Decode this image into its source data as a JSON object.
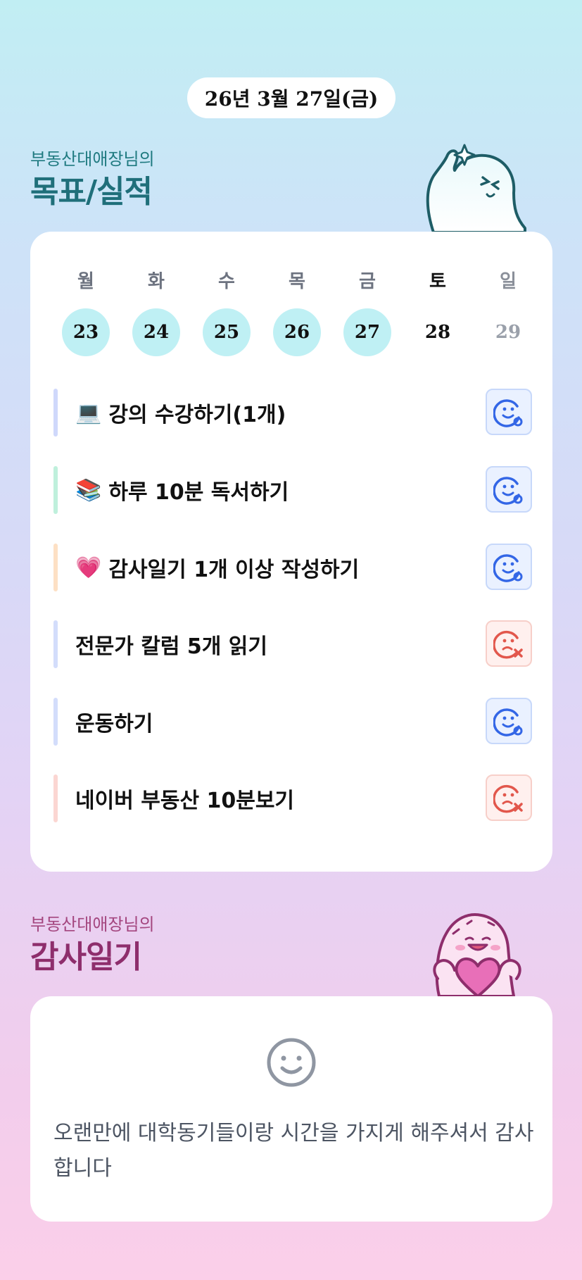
{
  "date_label": "26년 3월 27일(금)",
  "goals_section": {
    "subtitle": "부동산대애장님의",
    "title": "목표/실적"
  },
  "calendar": {
    "weekdays": [
      "월",
      "화",
      "수",
      "목",
      "금",
      "토",
      "일"
    ],
    "dates": [
      {
        "day": "23",
        "done": true
      },
      {
        "day": "24",
        "done": true
      },
      {
        "day": "25",
        "done": true
      },
      {
        "day": "26",
        "done": true
      },
      {
        "day": "27",
        "done": true
      },
      {
        "day": "28",
        "done": false
      },
      {
        "day": "29",
        "done": false
      }
    ]
  },
  "goals": [
    {
      "emoji": "💻",
      "label": "강의 수강하기(1개)",
      "bar_color": "#cfd8fb",
      "status": "done"
    },
    {
      "emoji": "📚",
      "label": "하루 10분 독서하기",
      "bar_color": "#bff0dc",
      "status": "done"
    },
    {
      "emoji": "💗",
      "label": "감사일기 1개 이상 작성하기",
      "bar_color": "#fde0c4",
      "status": "done"
    },
    {
      "emoji": "",
      "label": "전문가 칼럼 5개 읽기",
      "bar_color": "#d3ddfb",
      "status": "failed"
    },
    {
      "emoji": "",
      "label": "운동하기",
      "bar_color": "#d3ddfb",
      "status": "done"
    },
    {
      "emoji": "",
      "label": "네이버 부동산 10분보기",
      "bar_color": "#fbd6d2",
      "status": "failed"
    }
  ],
  "colors": {
    "done_icon": "#3366e6",
    "failed_icon": "#e2574c",
    "teal_accent": "#1f6f7a",
    "pink_accent": "#8e2e6c"
  },
  "icons": {
    "done": "smile-check-icon",
    "failed": "sad-x-icon",
    "diary": "smile-face-icon"
  },
  "diary_section": {
    "subtitle": "부동산대애장님의",
    "title": "감사일기",
    "text": "오랜만에 대학동기들이랑 시간을 가지게 해주셔서 감사합니다"
  }
}
